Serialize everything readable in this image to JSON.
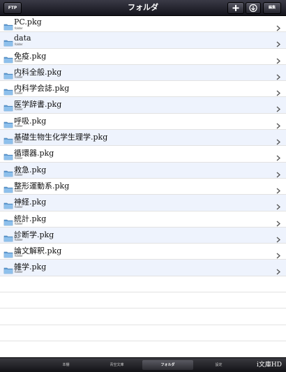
{
  "navbar": {
    "title": "フォルダ",
    "ftp_label": "FTP",
    "edit_label": "編集"
  },
  "items": [
    {
      "name": "PC.pkg",
      "type": "folder"
    },
    {
      "name": "data",
      "type": "folder"
    },
    {
      "name": "免疫.pkg",
      "type": "folder"
    },
    {
      "name": "内科全般.pkg",
      "type": "folder"
    },
    {
      "name": "内科学会誌.pkg",
      "type": "folder"
    },
    {
      "name": "医学辞書.pkg",
      "type": "folder"
    },
    {
      "name": "呼吸.pkg",
      "type": "folder"
    },
    {
      "name": "基礎生物生化学生理学.pkg",
      "type": "folder"
    },
    {
      "name": "循環器.pkg",
      "type": "folder"
    },
    {
      "name": "救急.pkg",
      "type": "folder"
    },
    {
      "name": "整形運動系.pkg",
      "type": "folder"
    },
    {
      "name": "神経.pkg",
      "type": "folder"
    },
    {
      "name": "統計.pkg",
      "type": "folder"
    },
    {
      "name": "診断学.pkg",
      "type": "folder"
    },
    {
      "name": "論文解釈.pkg",
      "type": "folder"
    },
    {
      "name": "雑学.pkg",
      "type": "folder"
    }
  ],
  "tabbar": {
    "tabs": [
      {
        "label": "本棚",
        "active": false
      },
      {
        "label": "青空文庫",
        "active": false
      },
      {
        "label": "フォルダ",
        "active": true
      },
      {
        "label": "設定",
        "active": false
      }
    ],
    "brand": "i文庫HD"
  },
  "colors": {
    "row_alt": "#eef3fd",
    "folder": "#6fa7d9",
    "nav_dark": "#14141c"
  }
}
